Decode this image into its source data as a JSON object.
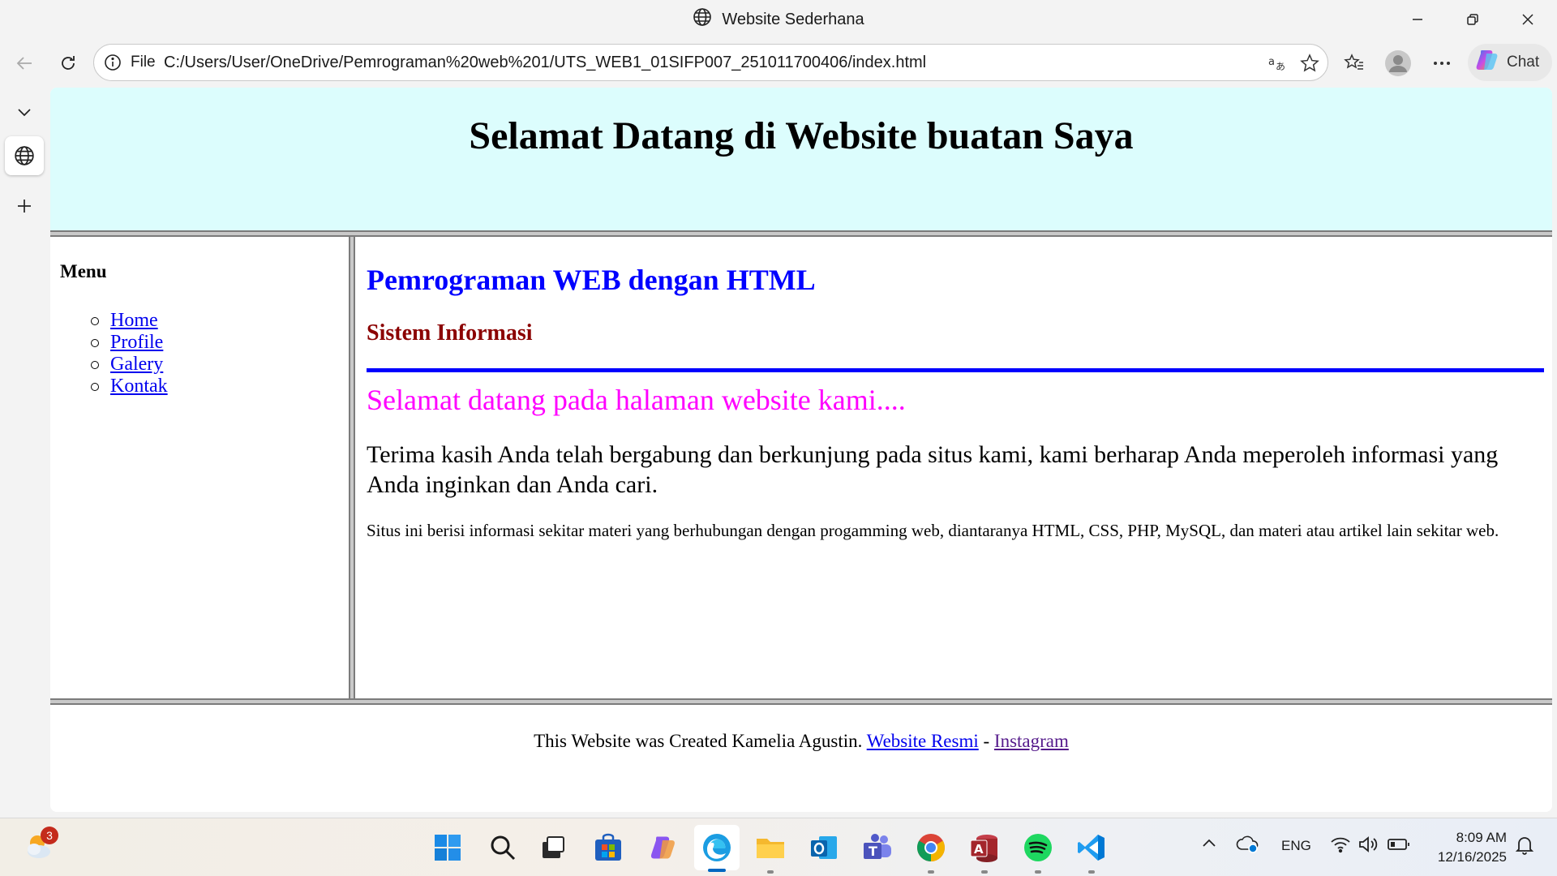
{
  "window": {
    "title": "Website Sederhana"
  },
  "address_bar": {
    "scheme_label": "File",
    "url": "C:/Users/User/OneDrive/Pemrograman%20web%201/UTS_WEB1_01SIFP007_251011700406/index.html"
  },
  "toolbar": {
    "chat_label": "Chat"
  },
  "page": {
    "header_title": "Selamat Datang di Website buatan Saya",
    "menu_title": "Menu",
    "menu_items": [
      "Home",
      "Profile",
      "Galery",
      "Kontak"
    ],
    "content_title": "Pemrograman WEB dengan HTML",
    "content_subtitle": "Sistem Informasi",
    "welcome": "Selamat datang pada halaman website kami....",
    "paragraph1": "Terima kasih Anda telah bergabung dan berkunjung pada situs kami, kami berharap Anda meperoleh informasi yang Anda inginkan dan Anda cari.",
    "paragraph2": "Situs ini berisi informasi sekitar materi yang berhubungan dengan progamming web, diantaranya HTML, CSS, PHP, MySQL, dan materi atau artikel lain sekitar web.",
    "footer_text": "This Website was Created Kamelia Agustin.",
    "footer_link1": "Website Resmi",
    "footer_separator": "-",
    "footer_link2": "Instagram"
  },
  "taskbar": {
    "weather_badge": "3",
    "apps": [
      "start-icon",
      "search-icon",
      "task-view-icon",
      "store-icon",
      "copilot-icon",
      "edge-icon",
      "file-explorer-icon",
      "outlook-icon",
      "teams-icon",
      "chrome-icon",
      "access-icon",
      "spotify-icon",
      "vscode-icon"
    ],
    "language": "ENG",
    "time": "8:09 AM",
    "date": "12/16/2025"
  },
  "colors": {
    "header_bg": "#dcfdfd",
    "content_title": "#0000ff",
    "content_subtitle": "#8b0000",
    "welcome": "#ff00ff",
    "link": "#0000ee",
    "visited_link": "#551a8b"
  }
}
